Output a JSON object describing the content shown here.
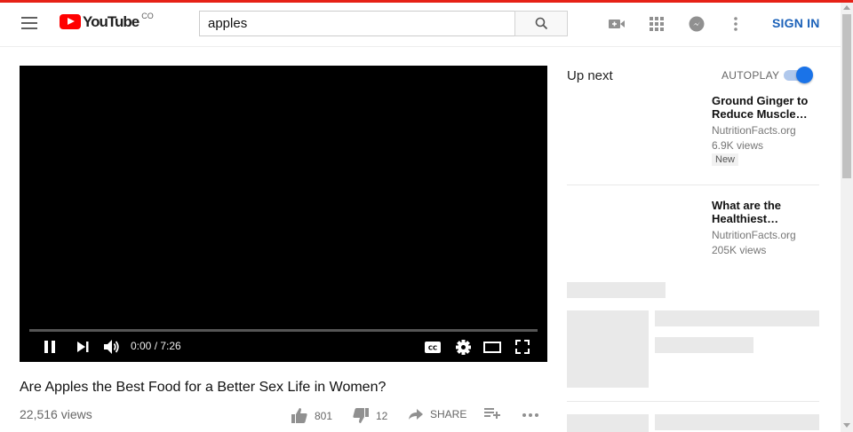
{
  "header": {
    "logo_text": "YouTube",
    "country_code": "CO",
    "search_value": "apples",
    "sign_in_label": "SIGN IN"
  },
  "player": {
    "time_display": "0:00 / 7:26",
    "progress": 0
  },
  "video": {
    "title": "Are Apples the Best Food for a Better Sex Life in Women?",
    "views": "22,516 views",
    "likes": "801",
    "dislikes": "12",
    "share_label": "SHARE"
  },
  "sidebar": {
    "up_next_label": "Up next",
    "autoplay_label": "AUTOPLAY",
    "autoplay_on": true,
    "recommendations": [
      {
        "title": "Ground Ginger to Reduce Muscle…",
        "channel": "NutritionFacts.org",
        "views": "6.9K views",
        "badge": "New"
      },
      {
        "title": "What are the Healthiest…",
        "channel": "NutritionFacts.org",
        "views": "205K views"
      }
    ]
  },
  "colors": {
    "brand_red": "#ff0000",
    "link_blue": "#1c62b9",
    "toggle_blue": "#1a73e8"
  }
}
